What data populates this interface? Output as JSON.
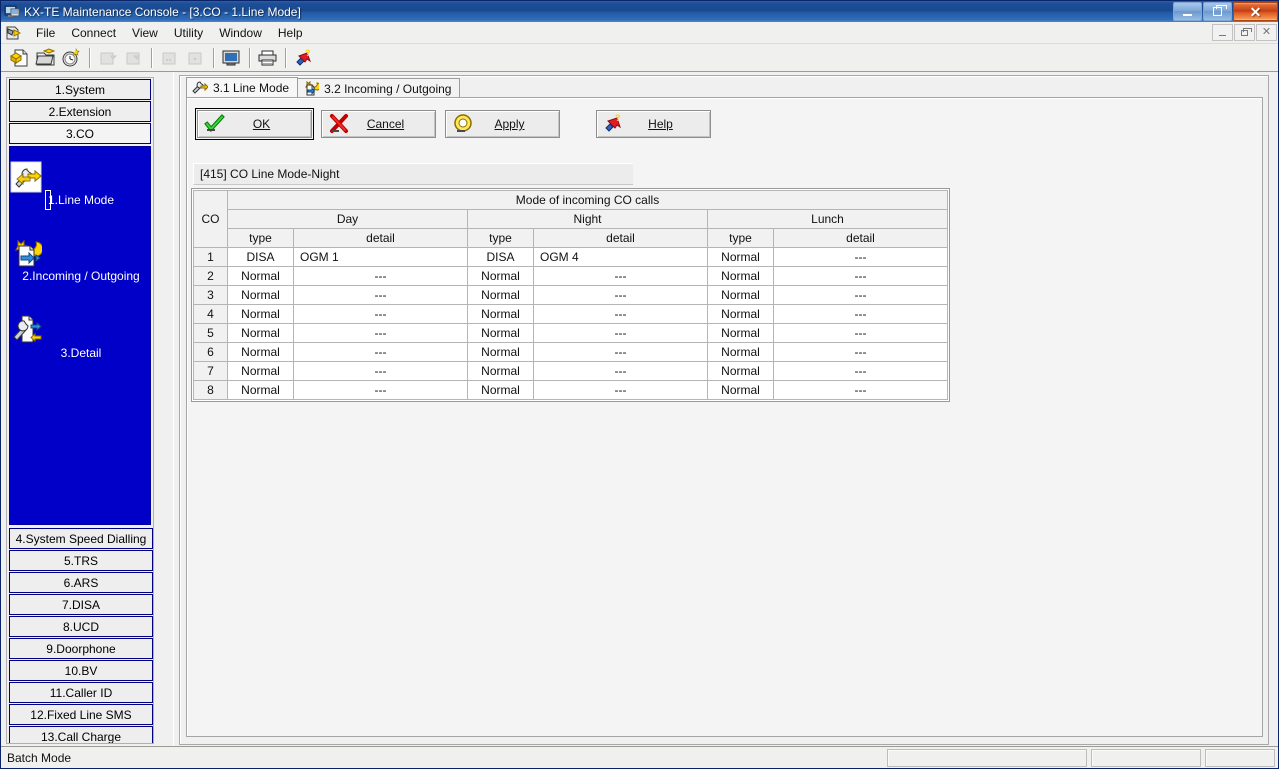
{
  "window": {
    "title": "KX-TE Maintenance Console - [3.CO - 1.Line Mode]",
    "app_icon": "console-window-icon",
    "controls": {
      "minimize": "minimize-icon",
      "restore": "restore-icon",
      "close": "close-icon"
    }
  },
  "menubar": {
    "icon": "mdi-document-icon",
    "items": [
      {
        "label": "File"
      },
      {
        "label": "Connect"
      },
      {
        "label": "View"
      },
      {
        "label": "Utility"
      },
      {
        "label": "Window"
      },
      {
        "label": "Help"
      }
    ],
    "mdi_controls": {
      "minimize": "mdi-minimize-icon",
      "restore": "mdi-restore-icon",
      "close": "mdi-close-icon"
    }
  },
  "toolbar": {
    "buttons": [
      {
        "name": "new-file-icon",
        "enabled": true
      },
      {
        "name": "open-folder-icon",
        "enabled": true
      },
      {
        "name": "wizard-clock-icon",
        "enabled": true
      },
      {
        "name": "upload-to-pbx-icon",
        "enabled": false
      },
      {
        "name": "download-from-pbx-icon",
        "enabled": false
      },
      {
        "name": "transfer-left-icon",
        "enabled": false
      },
      {
        "name": "transfer-right-icon",
        "enabled": false
      },
      {
        "name": "monitor-icon",
        "enabled": true
      },
      {
        "name": "print-icon",
        "enabled": true
      },
      {
        "name": "help-pointer-icon",
        "enabled": true
      }
    ]
  },
  "sidebar": {
    "top_items": [
      {
        "label": "1.System",
        "selected": false
      },
      {
        "label": "2.Extension",
        "selected": false
      },
      {
        "label": "3.CO",
        "selected": true
      }
    ],
    "panel_items": [
      {
        "label": "1.Line Mode",
        "icon": "wrench-arrows-icon",
        "selected": true
      },
      {
        "label": "2.Incoming / Outgoing",
        "icon": "day-night-call-icon",
        "selected": false
      },
      {
        "label": "3.Detail",
        "icon": "wrench-detail-icon",
        "selected": false
      }
    ],
    "bottom_items": [
      {
        "label": "4.System Speed Dialling"
      },
      {
        "label": "5.TRS"
      },
      {
        "label": "6.ARS"
      },
      {
        "label": "7.DISA"
      },
      {
        "label": "8.UCD"
      },
      {
        "label": "9.Doorphone"
      },
      {
        "label": "10.BV"
      },
      {
        "label": "11.Caller ID"
      },
      {
        "label": "12.Fixed Line SMS"
      },
      {
        "label": "13.Call Charge"
      }
    ]
  },
  "tabs": [
    {
      "label": "3.1 Line Mode",
      "icon": "line-mode-tab-icon",
      "active": true
    },
    {
      "label": "3.2 Incoming / Outgoing",
      "icon": "incoming-outgoing-tab-icon",
      "active": false
    }
  ],
  "actions": [
    {
      "name": "ok-button",
      "label": "OK",
      "accel": "O",
      "icon": "green-check-icon",
      "focused": true
    },
    {
      "name": "cancel-button",
      "label": "Cancel",
      "accel": "C",
      "icon": "red-x-icon",
      "focused": false
    },
    {
      "name": "apply-button",
      "label": "Apply",
      "accel": "A",
      "icon": "yellow-ring-icon",
      "focused": false
    },
    {
      "name": "help-button",
      "label": "Help",
      "accel": "H",
      "icon": "help-pointer-icon",
      "focused": false
    }
  ],
  "caption": "[415] CO Line Mode-Night",
  "grid": {
    "co_header": "CO",
    "group_header": "Mode of incoming CO calls",
    "modes": [
      "Day",
      "Night",
      "Lunch"
    ],
    "sub_headers": [
      "type",
      "detail"
    ],
    "rows": [
      {
        "co": "1",
        "day_type": "DISA",
        "day_detail": "OGM 1",
        "night_type": "DISA",
        "night_detail": "OGM 4",
        "lunch_type": "Normal",
        "lunch_detail": "---"
      },
      {
        "co": "2",
        "day_type": "Normal",
        "day_detail": "---",
        "night_type": "Normal",
        "night_detail": "---",
        "lunch_type": "Normal",
        "lunch_detail": "---"
      },
      {
        "co": "3",
        "day_type": "Normal",
        "day_detail": "---",
        "night_type": "Normal",
        "night_detail": "---",
        "lunch_type": "Normal",
        "lunch_detail": "---"
      },
      {
        "co": "4",
        "day_type": "Normal",
        "day_detail": "---",
        "night_type": "Normal",
        "night_detail": "---",
        "lunch_type": "Normal",
        "lunch_detail": "---"
      },
      {
        "co": "5",
        "day_type": "Normal",
        "day_detail": "---",
        "night_type": "Normal",
        "night_detail": "---",
        "lunch_type": "Normal",
        "lunch_detail": "---"
      },
      {
        "co": "6",
        "day_type": "Normal",
        "day_detail": "---",
        "night_type": "Normal",
        "night_detail": "---",
        "lunch_type": "Normal",
        "lunch_detail": "---"
      },
      {
        "co": "7",
        "day_type": "Normal",
        "day_detail": "---",
        "night_type": "Normal",
        "night_detail": "---",
        "lunch_type": "Normal",
        "lunch_detail": "---"
      },
      {
        "co": "8",
        "day_type": "Normal",
        "day_detail": "---",
        "night_type": "Normal",
        "night_detail": "---",
        "lunch_type": "Normal",
        "lunch_detail": "---"
      }
    ]
  },
  "statusbar": {
    "mode": "Batch Mode",
    "pane2": "",
    "pane3": "",
    "pane4": ""
  },
  "colors": {
    "title_blue": "#1a4a91",
    "nav_panel_blue": "#0000c8",
    "nav_border_navy": "#000080",
    "face": "#f0f0ee",
    "grid_line": "#b5b5b5"
  }
}
